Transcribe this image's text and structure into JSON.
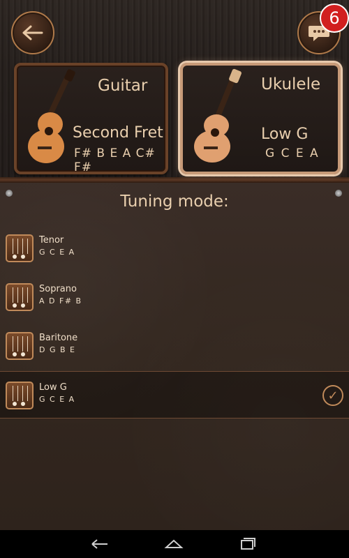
{
  "header": {
    "back_icon": "arrow-left-icon",
    "chat_icon": "chat-bubble-icon",
    "chat_badge": "6"
  },
  "instruments": [
    {
      "title": "Guitar",
      "subtitle": "Second Fret",
      "notes": "F# B E A C# F#",
      "selected": false
    },
    {
      "title": "Ukulele",
      "subtitle": "Low G",
      "notes": "G C E A",
      "selected": true
    }
  ],
  "tuning": {
    "title": "Tuning mode:",
    "modes": [
      {
        "name": "Tenor",
        "notes": "G C E A",
        "selected": false
      },
      {
        "name": "Soprano",
        "notes": "A D F# B",
        "selected": false
      },
      {
        "name": "Baritone",
        "notes": "D G B E",
        "selected": false
      },
      {
        "name": "Low G",
        "notes": "G C E A",
        "selected": true
      }
    ]
  },
  "navbar": {
    "back_icon": "nav-back-icon",
    "home_icon": "nav-home-icon",
    "recents_icon": "nav-recents-icon"
  },
  "colors": {
    "accent": "#c08a5a",
    "badge": "#d11f1f"
  }
}
